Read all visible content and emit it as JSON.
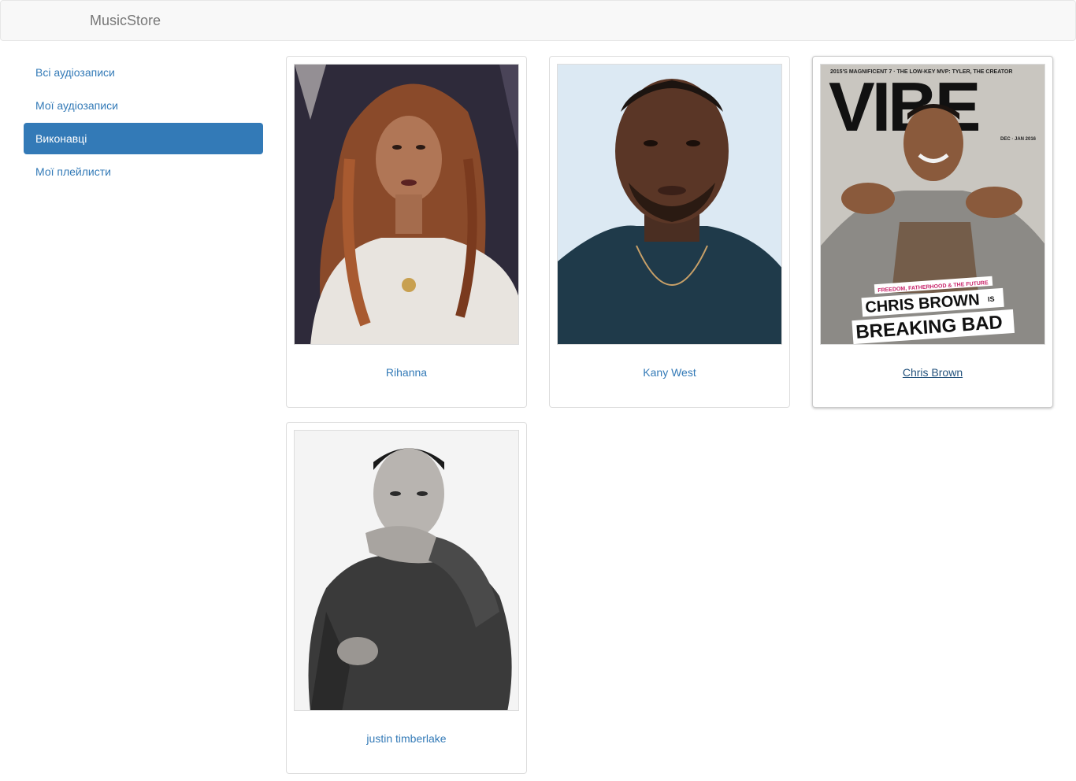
{
  "navbar": {
    "brand": "MusicStore"
  },
  "sidebar": {
    "items": [
      {
        "label": "Всі аудіозаписи",
        "active": false
      },
      {
        "label": "Мої аудіозаписи",
        "active": false
      },
      {
        "label": "Виконавці",
        "active": true
      },
      {
        "label": "Мої плейлисти",
        "active": false
      }
    ]
  },
  "artists": [
    {
      "name": "Rihanna",
      "photo": "rihanna-photo"
    },
    {
      "name": "Kany West",
      "photo": "kanye-photo"
    },
    {
      "name": "Chris Brown",
      "photo": "chris-brown-vibe-cover"
    },
    {
      "name": "justin timberlake",
      "photo": "justin-photo"
    }
  ],
  "vibe_cover": {
    "topline": "2015'S MAGNIFICENT 7 · THE LOW-KEY MVP: TYLER, THE CREATOR",
    "masthead": "VIBE",
    "issue": "DEC · JAN 2016",
    "tagline": "FREEDOM, FATHERHOOD & THE FUTURE",
    "headline1": "CHRIS BROWN",
    "headline_is": "IS",
    "headline2": "BREAKING BAD"
  },
  "colors": {
    "link": "#337ab7",
    "active_bg": "#337ab7",
    "navbar_bg": "#f8f8f8"
  }
}
